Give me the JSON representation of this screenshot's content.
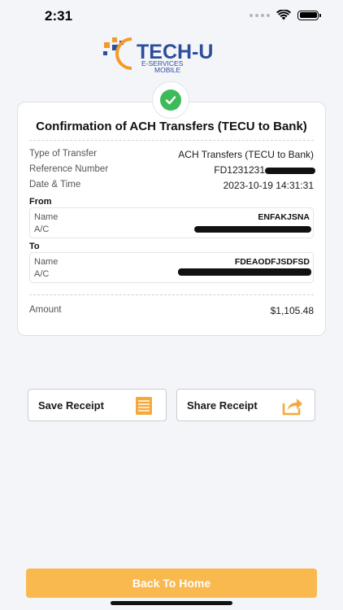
{
  "status_bar": {
    "time": "2:31"
  },
  "brand": {
    "name": "TECH-U",
    "subtitle_line1": "E-SERVICES",
    "subtitle_line2": "MOBILE",
    "orange": "#f39a2b",
    "blue": "#2d4e9a"
  },
  "confirmation": {
    "title": "Confirmation of ACH Transfers (TECU to Bank)",
    "rows": [
      {
        "label": "Type of Transfer",
        "value": "ACH Transfers (TECU to Bank)"
      },
      {
        "label": "Reference Number",
        "value": "FD1231231"
      },
      {
        "label": "Date & Time",
        "value": "2023-10-19 14:31:31"
      }
    ],
    "from": {
      "section": "From",
      "name_label": "Name",
      "name_value": "ENFAKJSNA",
      "account_label": "A/C"
    },
    "to": {
      "section": "To",
      "name_label": "Name",
      "name_value": "FDEAODFJSDFSD",
      "account_label": "A/C"
    },
    "amount": {
      "label": "Amount",
      "value": "$1,105.48"
    }
  },
  "actions": {
    "save_receipt": "Save Receipt",
    "share_receipt": "Share Receipt"
  },
  "footer": {
    "back_home": "Back To Home"
  },
  "colors": {
    "accent": "#f9b94f",
    "success": "#3dbb5a",
    "icon_orange": "#f5a93a"
  },
  "icons": {
    "wifi": "wifi-icon",
    "battery": "battery-icon",
    "check": "check-icon",
    "save": "document-stack-icon",
    "share": "share-icon"
  }
}
